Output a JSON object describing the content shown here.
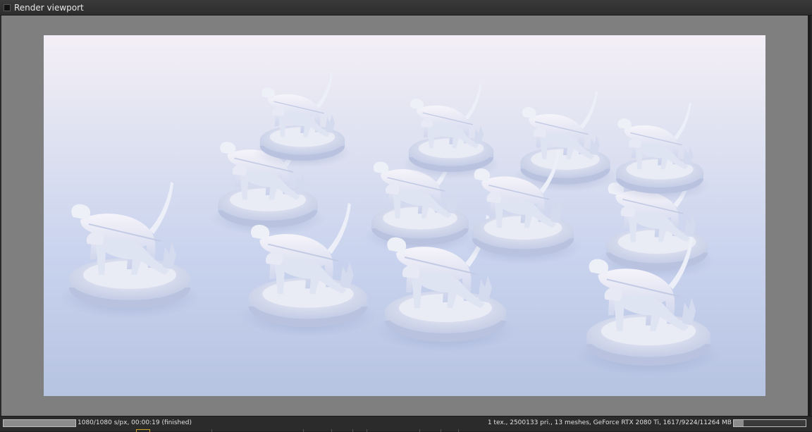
{
  "window": {
    "title": "Render viewport",
    "title_icon": "window-icon"
  },
  "render": {
    "scene": "figurines",
    "figurine_count": 12,
    "background_colors": [
      "#f4eff6",
      "#c9d3ee",
      "#b6c3e1"
    ],
    "figurine_color": "#dfe3f3"
  },
  "status": {
    "left_progress": 1.0,
    "left_text": "1080/1080 s/px, 00:00:19 (finished)",
    "right_text": "1 tex., 2500133 pri., 13 meshes, GeForce RTX 2080 Ti, 1617/9224/11264 MB",
    "memory_usage": 0.14
  }
}
